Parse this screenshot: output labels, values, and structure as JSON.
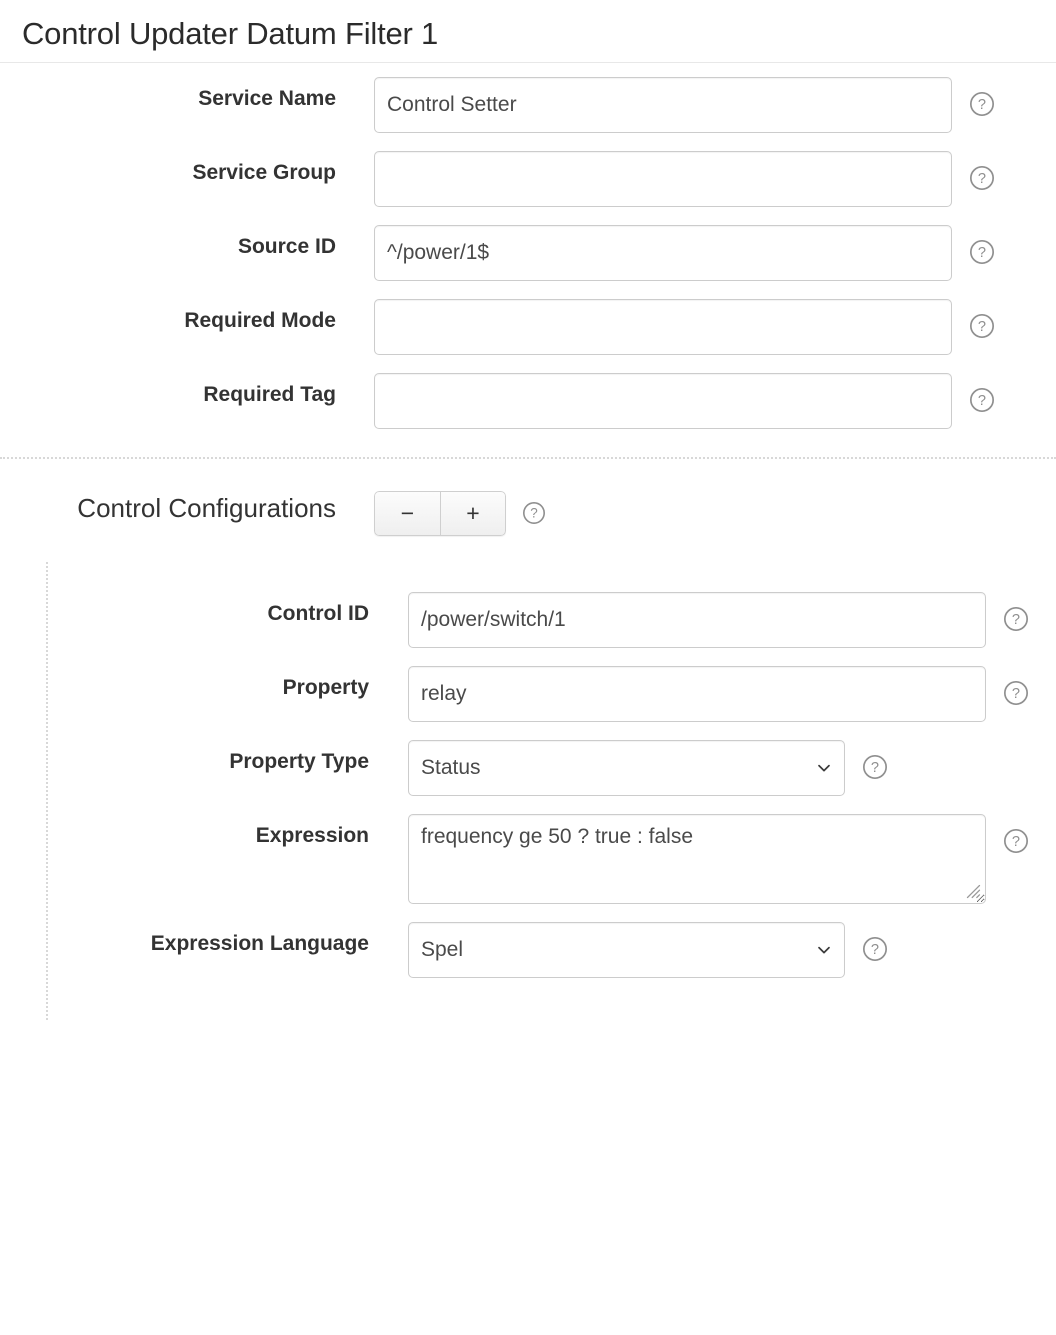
{
  "header": {
    "title": "Control Updater Datum Filter 1"
  },
  "icons": {
    "help": "help-circle-icon",
    "chevron": "chevron-down-icon",
    "minus": "minus-icon",
    "plus": "plus-icon",
    "resize": "resize-grip-icon"
  },
  "main_fields": [
    {
      "label": "Service Name",
      "value": "Control Setter",
      "placeholder": "",
      "type": "text",
      "name": "service-name"
    },
    {
      "label": "Service Group",
      "value": "",
      "placeholder": "",
      "type": "text",
      "name": "service-group"
    },
    {
      "label": "Source ID",
      "value": "^/power/1$",
      "placeholder": "",
      "type": "text",
      "name": "source-id"
    },
    {
      "label": "Required Mode",
      "value": "",
      "placeholder": "",
      "type": "text",
      "name": "required-mode"
    },
    {
      "label": "Required Tag",
      "value": "",
      "placeholder": "",
      "type": "text",
      "name": "required-tag"
    }
  ],
  "control_configurations": {
    "label": "Control Configurations",
    "remove_label": "−",
    "add_label": "+",
    "fields": [
      {
        "label": "Control ID",
        "value": "/power/switch/1",
        "placeholder": "",
        "type": "text",
        "name": "control-id"
      },
      {
        "label": "Property",
        "value": "relay",
        "placeholder": "",
        "type": "text",
        "name": "property"
      },
      {
        "label": "Property Type",
        "value": "Status",
        "type": "select",
        "name": "property-type",
        "options": [
          "Status"
        ]
      },
      {
        "label": "Expression",
        "value": "frequency ge 50 ? true : false",
        "placeholder": "",
        "type": "textarea",
        "name": "expression"
      },
      {
        "label": "Expression Language",
        "value": "Spel",
        "type": "select",
        "name": "expression-language",
        "options": [
          "Spel"
        ]
      }
    ]
  },
  "colors": {
    "text": "#333333",
    "border": "#cccccc",
    "divider": "#d8d8d8",
    "icon": "#8f8f8f"
  }
}
